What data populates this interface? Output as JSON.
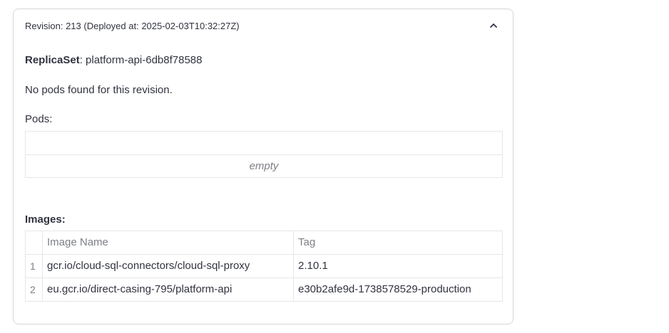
{
  "expander": {
    "title": "Revision: 213 (Deployed at: 2025-02-03T10:32:27Z)",
    "chevron_icon": "chevron-up-icon"
  },
  "replicaset": {
    "label": "ReplicaSet",
    "separator": ":",
    "value": " platform-api-6db8f78588"
  },
  "no_pods_message": "No pods found for this revision.",
  "pods": {
    "label": "Pods:",
    "empty_text": "empty"
  },
  "images": {
    "label": "Images:",
    "columns": [
      "",
      "Image Name",
      "Tag"
    ],
    "rows": [
      {
        "index": "1",
        "name": "gcr.io/cloud-sql-connectors/cloud-sql-proxy",
        "tag": "2.10.1"
      },
      {
        "index": "2",
        "name": "eu.gcr.io/direct-casing-795/platform-api",
        "tag": "e30b2afe9d-1738578529-production"
      }
    ]
  }
}
